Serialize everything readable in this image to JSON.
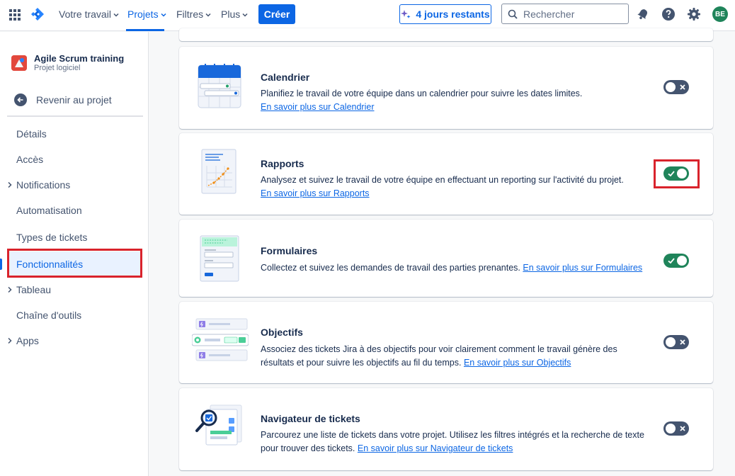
{
  "topbar": {
    "nav": [
      {
        "label": "Votre travail"
      },
      {
        "label": "Projets"
      },
      {
        "label": "Filtres"
      },
      {
        "label": "Plus"
      }
    ],
    "create_label": "Créer",
    "trial_label": "4 jours restants",
    "search_placeholder": "Rechercher",
    "avatar_initials": "BE"
  },
  "sidebar": {
    "project_name": "Agile Scrum training",
    "project_type": "Projet logiciel",
    "back_label": "Revenir au projet",
    "items": [
      {
        "label": "Détails"
      },
      {
        "label": "Accès"
      },
      {
        "label": "Notifications"
      },
      {
        "label": "Automatisation"
      },
      {
        "label": "Types de tickets"
      },
      {
        "label": "Fonctionnalités"
      },
      {
        "label": "Tableau"
      },
      {
        "label": "Chaîne d'outils"
      },
      {
        "label": "Apps"
      }
    ]
  },
  "features": [
    {
      "title": "Calendrier",
      "desc": "Planifiez le travail de votre équipe dans un calendrier pour suivre les dates limites.",
      "link": "En savoir plus sur Calendrier",
      "enabled": false
    },
    {
      "title": "Rapports",
      "desc": "Analysez et suivez le travail de votre équipe en effectuant un reporting sur l'activité du projet.",
      "link": "En savoir plus sur Rapports",
      "enabled": true
    },
    {
      "title": "Formulaires",
      "desc": "Collectez et suivez les demandes de travail des parties prenantes.",
      "link": "En savoir plus sur Formulaires",
      "enabled": true
    },
    {
      "title": "Objectifs",
      "desc": "Associez des tickets Jira à des objectifs pour voir clairement comment le travail génère des résultats et pour suivre les objectifs au fil du temps.",
      "link": "En savoir plus sur Objectifs",
      "enabled": false
    },
    {
      "title": "Navigateur de tickets",
      "desc": "Parcourez une liste de tickets dans votre projet. Utilisez les filtres intégrés et la recherche de texte pour trouver des tickets.",
      "link": "En savoir plus sur Navigateur de tickets",
      "enabled": false
    }
  ],
  "colors": {
    "accent": "#0c66e4",
    "toggle_on": "#1f845a",
    "toggle_off": "#44546f",
    "highlight": "#d9232c"
  }
}
